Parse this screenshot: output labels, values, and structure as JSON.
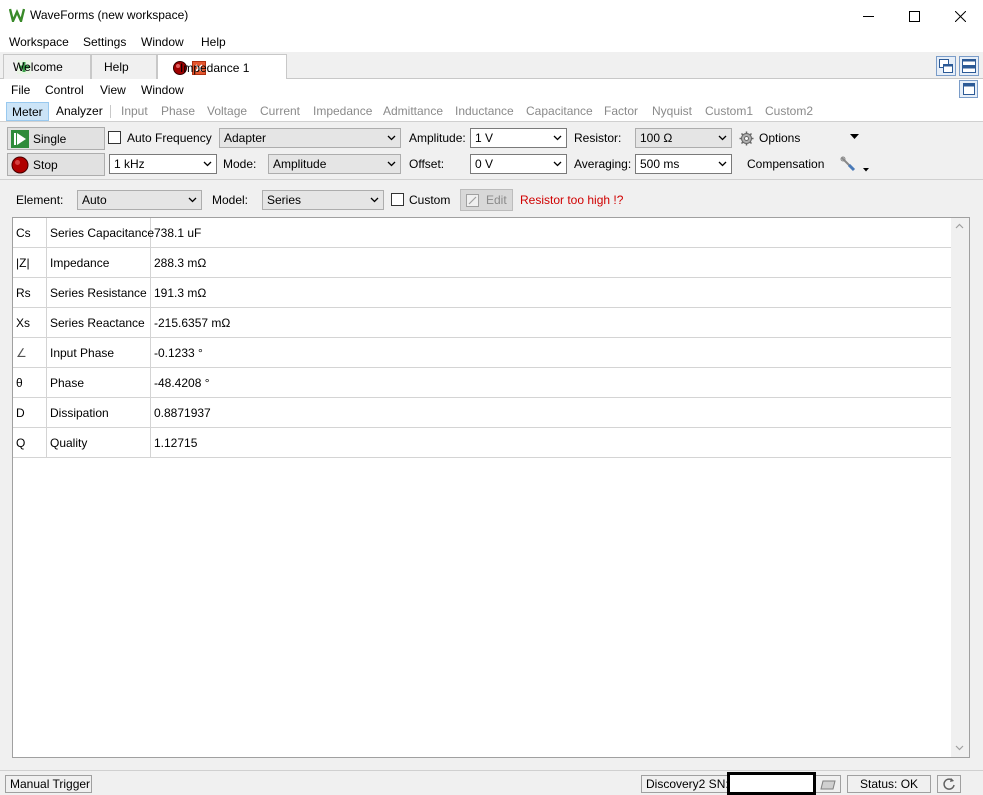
{
  "window": {
    "title": "WaveForms (new workspace)",
    "minimize": "minimize",
    "maximize": "maximize",
    "close": "close"
  },
  "menubar": {
    "items": [
      "Workspace",
      "Settings",
      "Window",
      "Help"
    ]
  },
  "tabs": [
    {
      "label": "Welcome"
    },
    {
      "label": "Help"
    },
    {
      "label": "Impedance 1"
    }
  ],
  "doc_menu": {
    "items": [
      "File",
      "Control",
      "View",
      "Window"
    ]
  },
  "subtabs": {
    "items": [
      "Meter",
      "Analyzer",
      "Input",
      "Phase",
      "Voltage",
      "Current",
      "Impedance",
      "Admittance",
      "Inductance",
      "Capacitance",
      "Factor",
      "Nyquist",
      "Custom1",
      "Custom2"
    ],
    "selected": "Meter"
  },
  "toolbar": {
    "single_label": "Single",
    "stop_label": "Stop",
    "auto_frequency_label": "Auto Frequency",
    "auto_frequency_checked": false,
    "adapter_value": "Adapter",
    "frequency_value": "1 kHz",
    "mode_label": "Mode:",
    "mode_value": "Amplitude",
    "amplitude_label": "Amplitude:",
    "amplitude_value": "1 V",
    "offset_label": "Offset:",
    "offset_value": "0 V",
    "resistor_label": "Resistor:",
    "resistor_value": "100 Ω",
    "averaging_label": "Averaging:",
    "averaging_value": "500 ms",
    "options_label": "Options",
    "compensation_label": "Compensation"
  },
  "element_bar": {
    "element_label": "Element:",
    "element_value": "Auto",
    "model_label": "Model:",
    "model_value": "Series",
    "custom_label": "Custom",
    "custom_checked": false,
    "edit_label": "Edit",
    "warning": "Resistor too high !?",
    "warning_color": "#d00000"
  },
  "measurements": [
    {
      "symbol": "Cs",
      "name": "Series Capacitance",
      "value": "738.1 uF"
    },
    {
      "symbol": "|Z|",
      "name": "Impedance",
      "value": "288.3 mΩ"
    },
    {
      "symbol": "Rs",
      "name": "Series Resistance",
      "value": "191.3 mΩ"
    },
    {
      "symbol": "Xs",
      "name": "Series Reactance",
      "value": "-215.6357 mΩ"
    },
    {
      "symbol": "∠",
      "name": "Input Phase",
      "value": "-0.1233 °"
    },
    {
      "symbol": "θ",
      "name": "Phase",
      "value": "-48.4208 °"
    },
    {
      "symbol": "D",
      "name": "Dissipation",
      "value": "0.8871937"
    },
    {
      "symbol": "Q",
      "name": "Quality",
      "value": "1.12715"
    }
  ],
  "statusbar": {
    "manual_trigger": "Manual Trigger",
    "device": "Discovery2 SN:",
    "status": "Status: OK"
  },
  "colors": {
    "stop_red": "#c00000",
    "play_green": "#2e8b3a",
    "selected_tab": "#cce4f7",
    "warning": "#d00000"
  }
}
